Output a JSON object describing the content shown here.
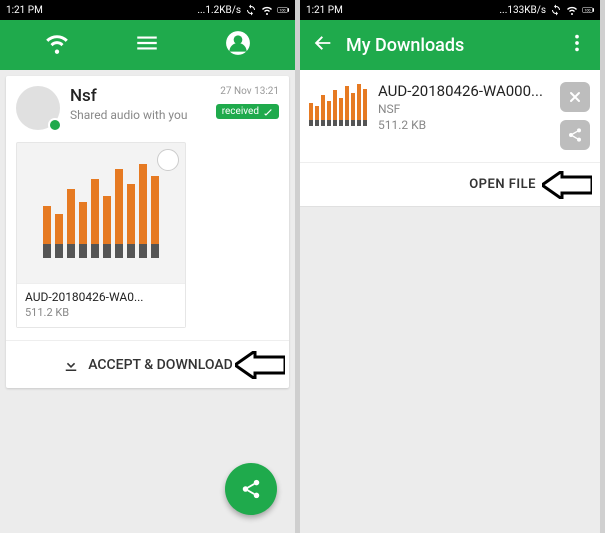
{
  "status": {
    "time": "1:21 PM",
    "net_left": "1.2KB/s",
    "net_right": "133KB/s",
    "battery": "100"
  },
  "left": {
    "post": {
      "name": "Nsf",
      "subtitle": "Shared audio with you",
      "timestamp": "27 Nov 13:21",
      "badge": "received"
    },
    "attachment": {
      "filename": "AUD-20180426-WA0...",
      "filesize": "511.2 KB"
    },
    "accept_label": "ACCEPT & DOWNLOAD"
  },
  "right": {
    "title": "My Downloads",
    "file": {
      "filename": "AUD-20180426-WA000...",
      "filetype": "NSF",
      "filesize": "511.2 KB"
    },
    "open_label": "OPEN FILE"
  },
  "chart_data": {
    "type": "bar",
    "note": "audio waveform thumbnail, bar heights are relative/estimated",
    "heights": [
      38,
      30,
      55,
      42,
      65,
      48,
      75,
      60,
      80,
      68
    ],
    "stub": 14,
    "color_top": "#e67a22",
    "color_bot": "#555"
  }
}
